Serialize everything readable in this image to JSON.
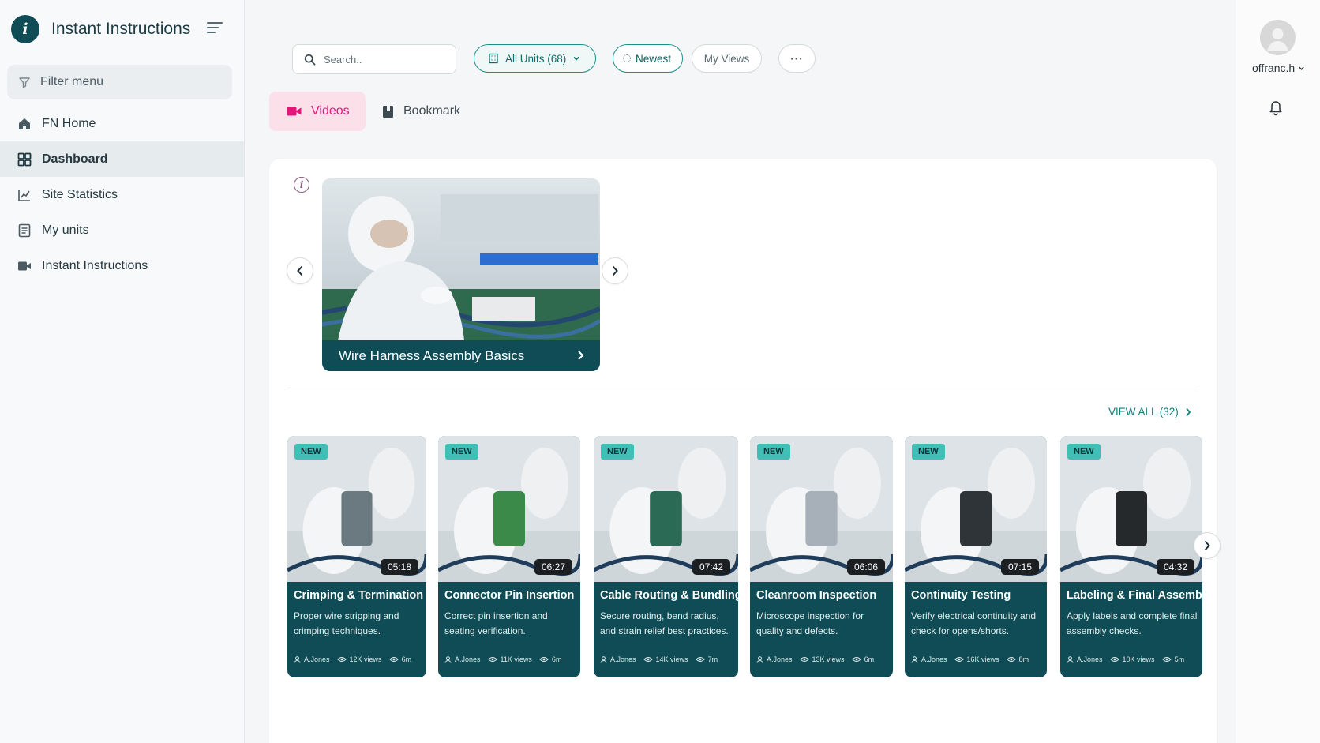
{
  "app": {
    "title": "Instant Instructions",
    "logo_letter": "i"
  },
  "sidebar": {
    "filter_label": "Filter menu",
    "items": [
      {
        "label": "FN Home",
        "icon": "home-icon",
        "active": false
      },
      {
        "label": "Dashboard",
        "icon": "dashboard-icon",
        "active": true
      },
      {
        "label": "Site Statistics",
        "icon": "chart-icon",
        "active": false
      },
      {
        "label": "My units",
        "icon": "list-icon",
        "active": false
      },
      {
        "label": "Instant Instructions",
        "icon": "video-icon",
        "active": false
      }
    ]
  },
  "toolbar": {
    "search_placeholder": "Search..",
    "units_label": "All Units (68)",
    "newest_label": "Newest",
    "myviews_label": "My Views",
    "more_label": "···"
  },
  "user": {
    "name": "offranc.h"
  },
  "tabs": [
    {
      "label": "Videos",
      "active": true
    },
    {
      "label": "Bookmark",
      "active": false
    }
  ],
  "featured": {
    "title": "Wire Harness Assembly Basics"
  },
  "view_all": "VIEW ALL (32)",
  "videos": [
    {
      "badge": "NEW",
      "duration": "05:18",
      "title": "Crimping & Termination",
      "desc": "Proper wire stripping and crimping techniques.",
      "author": "A.Jones",
      "views": "12K views",
      "time": "6m",
      "accent": "#6b7a80"
    },
    {
      "badge": "NEW",
      "duration": "06:27",
      "title": "Connector Pin Insertion",
      "desc": "Correct pin insertion and seating verification.",
      "author": "A.Jones",
      "views": "11K views",
      "time": "6m",
      "accent": "#3c8a4a"
    },
    {
      "badge": "NEW",
      "duration": "07:42",
      "title": "Cable Routing & Bundling",
      "desc": "Secure routing, bend radius, and strain relief best practices.",
      "author": "A.Jones",
      "views": "14K views",
      "time": "7m",
      "accent": "#2b6b55"
    },
    {
      "badge": "NEW",
      "duration": "06:06",
      "title": "Cleanroom Inspection",
      "desc": "Microscope inspection for quality and defects.",
      "author": "A.Jones",
      "views": "13K views",
      "time": "6m",
      "accent": "#a7b0b8"
    },
    {
      "badge": "NEW",
      "duration": "07:15",
      "title": "Continuity Testing",
      "desc": "Verify electrical continuity and check for opens/shorts.",
      "author": "A.Jones",
      "views": "16K views",
      "time": "8m",
      "accent": "#2f3438"
    },
    {
      "badge": "NEW",
      "duration": "04:32",
      "title": "Labeling & Final Assembly",
      "desc": "Apply labels and complete final assembly checks.",
      "author": "A.Jones",
      "views": "10K views",
      "time": "5m",
      "accent": "#26292c"
    }
  ]
}
